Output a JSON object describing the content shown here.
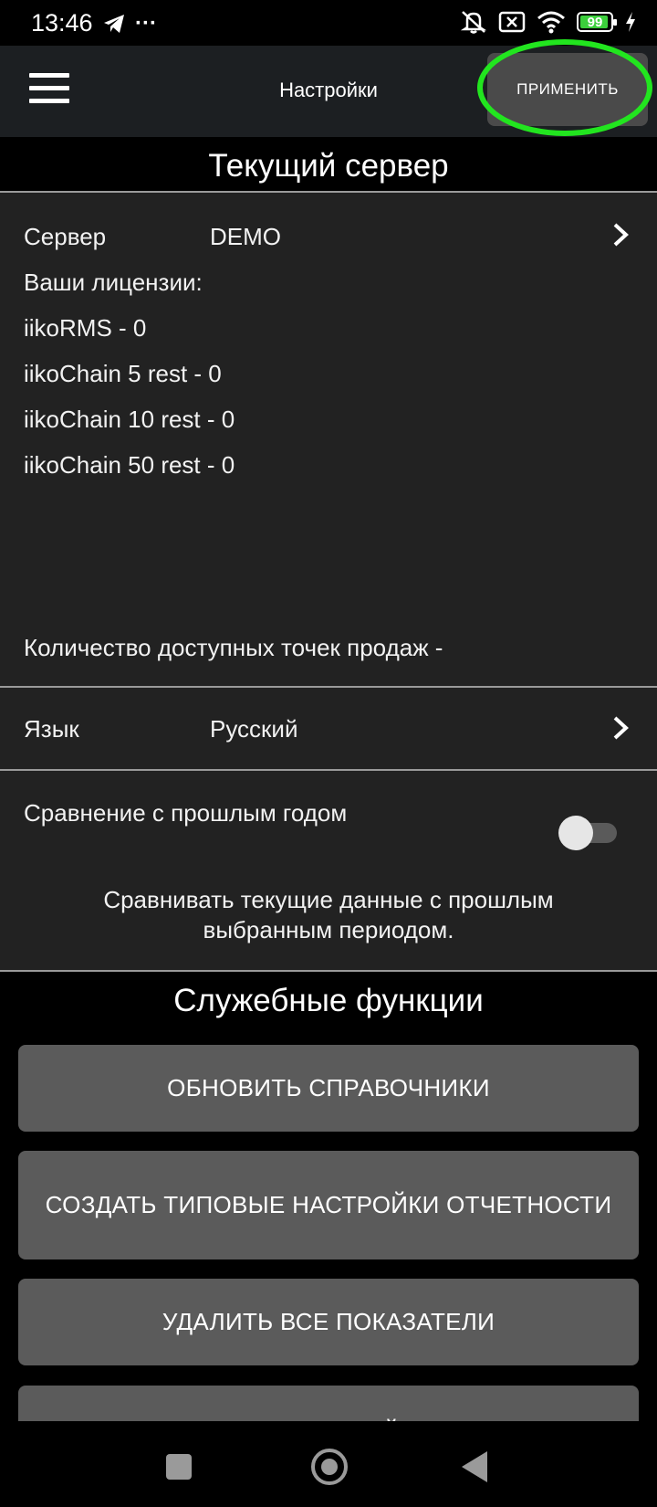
{
  "status_bar": {
    "time": "13:46",
    "icons": [
      "telegram-icon",
      "more-dots-icon",
      "mute-icon",
      "sim-off-icon",
      "wifi-icon",
      "battery-icon",
      "charging-icon"
    ],
    "battery_level": "99",
    "more_glyph": "···"
  },
  "toolbar": {
    "title": "Настройки",
    "apply_label": "ПРИМЕНИТЬ",
    "highlight_color": "#22e51f"
  },
  "current_server": {
    "section_title": "Текущий сервер",
    "server_label": "Сервер",
    "server_value": "DEMO",
    "licenses_title": "Ваши лицензии:",
    "licenses": [
      "iikoRMS - 0",
      "iikoChain 5 rest - 0",
      "iikoChain 10 rest - 0",
      "iikoChain 50 rest - 0"
    ],
    "pos_count_text": "Количество доступных точек продаж -"
  },
  "language": {
    "label": "Язык",
    "value": "Русский"
  },
  "comparison": {
    "label": "Сравнение с прошлым годом",
    "enabled": false,
    "note_line1": "Сравнивать текущие данные с прошлым",
    "note_line2": "выбранным периодом."
  },
  "service": {
    "section_title": "Служебные функции",
    "buttons": [
      "ОБНОВИТЬ СПРАВОЧНИКИ",
      "СОЗДАТЬ ТИПОВЫЕ НАСТРОЙКИ ОТЧЕТНОСТИ",
      "УДАЛИТЬ ВСЕ ПОКАЗАТЕЛИ",
      "УДАЛИТЬ ВСЕ ВЕЙТИНГИ"
    ]
  },
  "colors": {
    "background": "#000000",
    "panel": "#222222",
    "toolbar": "#1c1f22",
    "button": "#5b5b5b",
    "accent_highlight": "#22e51f"
  },
  "nav_bar": {
    "icons": [
      "recents-square-icon",
      "home-circle-icon",
      "back-triangle-icon"
    ]
  }
}
